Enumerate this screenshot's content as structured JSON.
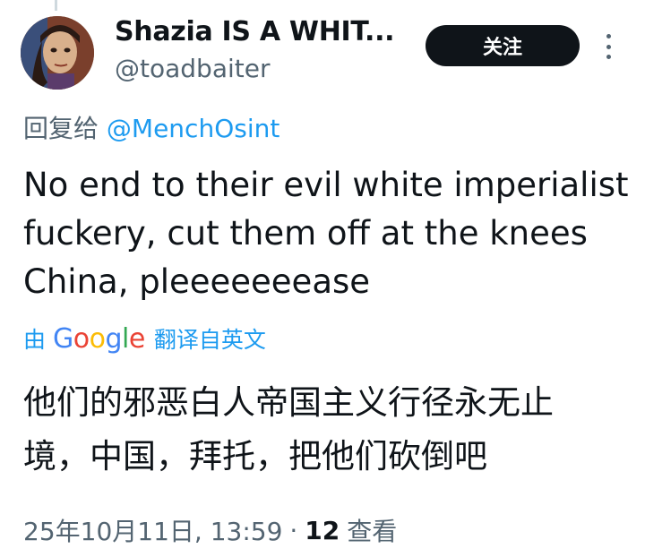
{
  "author": {
    "display_name": "Shazia IS A WHIT...",
    "handle": "@toadbaiter",
    "avatar_icon": "profile-portrait"
  },
  "actions": {
    "follow_label": "关注",
    "more_icon": "more-vertical-icon"
  },
  "reply": {
    "prefix": "回复给",
    "mention": "@MenchOsint"
  },
  "tweet": {
    "lines": [
      "No end to their evil white imperialist",
      "fuckery, cut them off at the knees",
      "China, pleeeeeeease"
    ]
  },
  "translation": {
    "by": "由",
    "provider_letters": [
      "G",
      "o",
      "o",
      "g",
      "l",
      "e"
    ],
    "from": "翻译自英文",
    "lines": [
      "他们的邪恶白人帝国主义行径永无止",
      "境，中国，拜托，把他们砍倒吧"
    ]
  },
  "meta": {
    "timestamp": "25年10月11日, 13:59",
    "separator": "·",
    "views_count": "12",
    "views_label": "查看"
  },
  "colors": {
    "link": "#1d9bf0",
    "secondary_text": "#536471",
    "primary_text": "#0f1419",
    "follow_button_bg": "#0f1419"
  }
}
